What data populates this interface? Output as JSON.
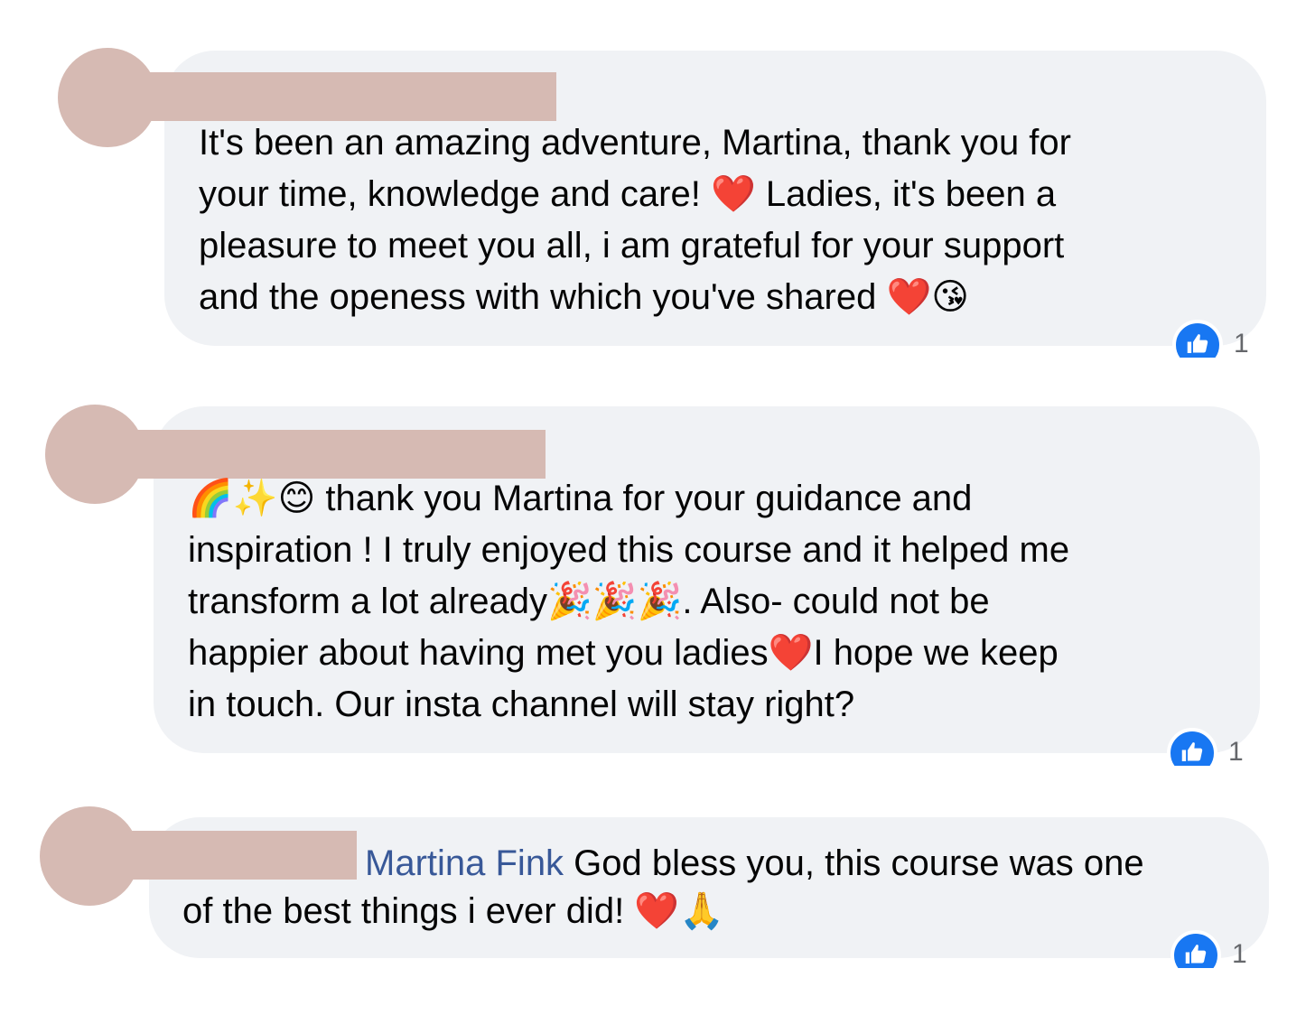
{
  "comments": [
    {
      "text_lines": [
        "It's been an amazing adventure, Martina, thank you for",
        "your time, knowledge and care! ❤️ Ladies, it's been a",
        "pleasure to meet you all, i am grateful for your support",
        "and the openess with which you've shared ❤️😘"
      ],
      "reaction": {
        "icon": "like-icon",
        "count": "1"
      }
    },
    {
      "text_lines": [
        "🌈✨😊 thank you Martina for your guidance and",
        "inspiration ! I truly enjoyed this course and it helped me",
        "transform a lot already🎉🎉🎉. Also- could not be",
        "happier about having met you ladies❤️I hope we keep",
        "in touch. Our insta channel will stay right?"
      ],
      "reaction": {
        "icon": "like-icon",
        "count": "1"
      }
    },
    {
      "mention": "Martina Fink",
      "text_lines": [
        " God bless you, this course was one",
        "of the best things i ever did! ❤️🙏"
      ],
      "reaction": {
        "icon": "like-icon",
        "count": "1"
      }
    }
  ],
  "colors": {
    "bubble": "#f0f2f5",
    "redaction": "#d6bab3",
    "mention": "#385898",
    "like": "#1877f2"
  }
}
